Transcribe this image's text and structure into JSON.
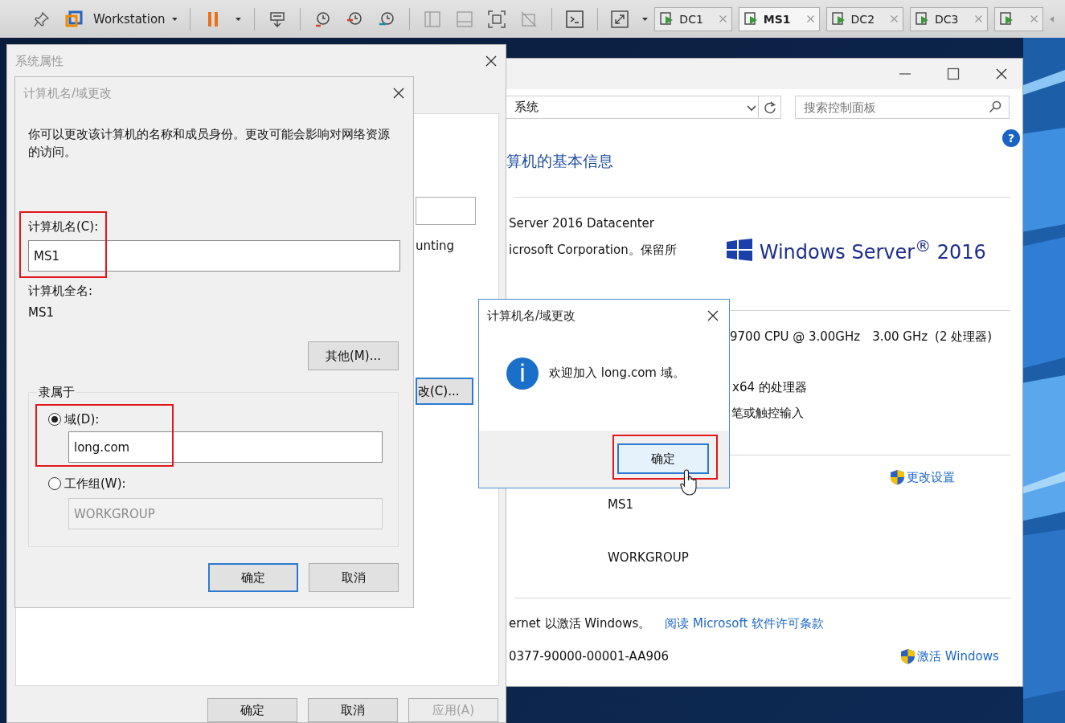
{
  "toolbar": {
    "app_label": "Workstation",
    "tabs": [
      {
        "label": "DC1",
        "selected": false
      },
      {
        "label": "MS1",
        "selected": true
      },
      {
        "label": "DC2",
        "selected": false
      },
      {
        "label": "DC3",
        "selected": false
      },
      {
        "selected": false
      }
    ]
  },
  "control_panel": {
    "help_label": "?",
    "address": "系统",
    "search_placeholder": "搜索控制面板",
    "heading": "算机的基本信息",
    "edition": "Server 2016 Datacenter",
    "copyright": "icrosoft Corporation。保留所",
    "logo_text": "Windows Server$^{®}$ 2016",
    "processor": "9700 CPU @ 3.00GHz",
    "speed": "3.00 GHz",
    "processor_count": "(2 处理器)",
    "system_type": "x64 的处理器",
    "pen_touch": "笔或触控输入",
    "change_settings": "更改设置",
    "computer_name": "MS1",
    "workgroup": "WORKGROUP",
    "activation_text": "ernet 以激活 Windows。",
    "license_link": "阅读 Microsoft 软件许可条款",
    "product_id": "0377-90000-00001-AA906",
    "activate_link": "激活 Windows"
  },
  "system_properties": {
    "title": "系统属性",
    "active": false,
    "text_fragment": "unting",
    "button_fragment": "改(C)...",
    "buttons": [
      {
        "label": "确定",
        "disabled": false
      },
      {
        "label": "取消",
        "disabled": false
      },
      {
        "label": "应用(A)",
        "disabled": true
      }
    ]
  },
  "name_dialog": {
    "title": "计算机名/域更改",
    "active": false,
    "description": "你可以更改该计算机的名称和成员身份。更改可能会影响对网络资源的访问。",
    "name_label": "计算机名(C):",
    "name_value": "MS1",
    "name_highlighted": true,
    "full_name_label": "计算机全名:",
    "full_name": "MS1",
    "more_button": "其他(M)...",
    "member_of": {
      "label": "隶属于",
      "options": [
        {
          "label": "域(D):",
          "selected": true,
          "value": "long.com",
          "highlighted": true
        },
        {
          "label": "工作组(W):",
          "selected": false,
          "value": "WORKGROUP",
          "highlighted": false
        }
      ]
    },
    "buttons": [
      {
        "label": "确定",
        "default": true
      },
      {
        "label": "取消",
        "default": false
      }
    ]
  },
  "message_box": {
    "title": "计算机名/域更改",
    "active": true,
    "message": "欢迎加入 long.com 域。",
    "button": {
      "label": "确定",
      "default": true,
      "highlighted": true
    }
  }
}
